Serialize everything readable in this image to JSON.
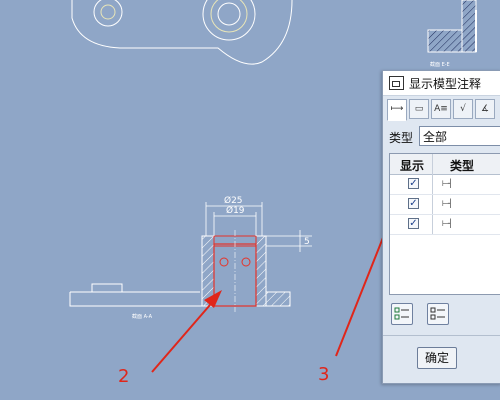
{
  "drawing": {
    "dim_outer": "Ø25",
    "dim_inner": "Ø19",
    "dim_depth": "5",
    "section_label": "截面  A-A",
    "section_label_right": "截面  E-E"
  },
  "dialog": {
    "title": "显示模型注释",
    "type_label": "类型",
    "type_value": "全部",
    "col_show": "显示",
    "col_type": "类型",
    "ok_label": "确定",
    "rows": [
      {
        "checked": "✓"
      },
      {
        "checked": "✓"
      },
      {
        "checked": "✓"
      }
    ]
  },
  "annotations": {
    "label_2": "2",
    "label_3": "3",
    "arrow_color": "#e0261a"
  }
}
